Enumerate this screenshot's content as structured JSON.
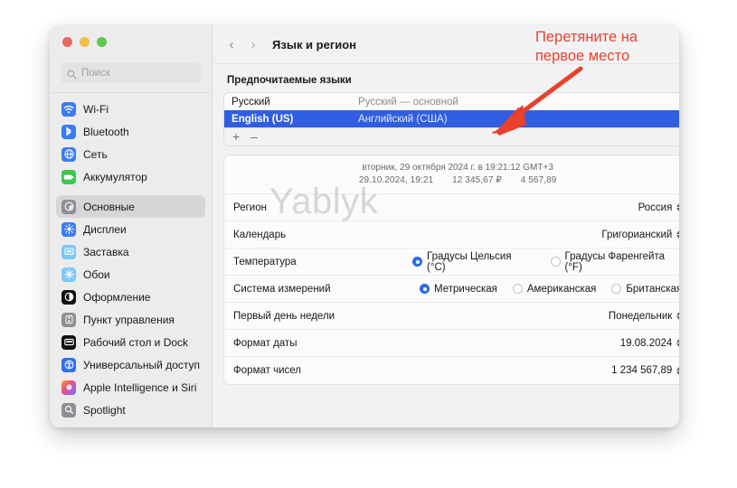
{
  "window": {
    "traffic_lights": [
      "close",
      "minimize",
      "zoom"
    ],
    "search": {
      "placeholder": "Поиск",
      "value": ""
    }
  },
  "sidebar": {
    "groups": [
      {
        "items": [
          {
            "label": "Wi-Fi",
            "icon": "wifi-icon",
            "color": "#3b7bf5",
            "selected": false
          },
          {
            "label": "Bluetooth",
            "icon": "bluetooth-icon",
            "color": "#3b7bf5",
            "selected": false
          },
          {
            "label": "Сеть",
            "icon": "network-globe-icon",
            "color": "#3b7bf5",
            "selected": false
          },
          {
            "label": "Аккумулятор",
            "icon": "battery-icon",
            "color": "#3cc750",
            "selected": false
          }
        ]
      },
      {
        "items": [
          {
            "label": "Основные",
            "icon": "general-gear-icon",
            "color": "#8e8e93",
            "selected": true
          },
          {
            "label": "Дисплеи",
            "icon": "display-brightness-icon",
            "color": "#3b7bf5",
            "selected": false
          },
          {
            "label": "Заставка",
            "icon": "screensaver-icon",
            "color": "#7fc7f5",
            "selected": false
          },
          {
            "label": "Обои",
            "icon": "wallpaper-icon",
            "color": "#7fc7f5",
            "selected": false
          },
          {
            "label": "Оформление",
            "icon": "appearance-contrast-icon",
            "color": "#111113",
            "selected": false
          },
          {
            "label": "Пункт управления",
            "icon": "control-center-icon",
            "color": "#8e8e93",
            "selected": false
          },
          {
            "label": "Рабочий стол и Dock",
            "icon": "desktop-dock-icon",
            "color": "#111113",
            "selected": false
          },
          {
            "label": "Универсальный доступ",
            "icon": "accessibility-icon",
            "color": "#2f6fe8",
            "selected": false
          },
          {
            "label": "Apple Intelligence и Siri",
            "icon": "siri-icon",
            "color": "#d96ab0",
            "selected": false
          },
          {
            "label": "Spotlight",
            "icon": "spotlight-search-icon",
            "color": "#8e8e93",
            "selected": false
          }
        ]
      }
    ]
  },
  "toolbar": {
    "back_label": "‹",
    "forward_label": "›",
    "title": "Язык и регион"
  },
  "languages": {
    "section_title": "Предпочитаемые языки",
    "rows": [
      {
        "name": "Русский",
        "desc": "Русский — основной",
        "selected": false
      },
      {
        "name": "English (US)",
        "desc": "Английский (США)",
        "selected": true
      }
    ],
    "add_label": "+",
    "remove_label": "–"
  },
  "preview": {
    "line1": "вторник, 29 октября 2024 г. в 19:21:12 GMT+3",
    "line2_date": "29.10.2024, 19:21",
    "line2_currency": "12 345,67 ₽",
    "line2_number": "4 567,89"
  },
  "settings": {
    "rows": [
      {
        "type": "popup",
        "label": "Регион",
        "value": "Россия"
      },
      {
        "type": "popup",
        "label": "Календарь",
        "value": "Григорианский"
      },
      {
        "type": "radio",
        "label": "Температура",
        "options": [
          {
            "label": "Градусы Цельсия (°C)",
            "selected": true
          },
          {
            "label": "Градусы Фаренгейта (°F)",
            "selected": false
          }
        ]
      },
      {
        "type": "radio",
        "label": "Система измерений",
        "options": [
          {
            "label": "Метрическая",
            "selected": true
          },
          {
            "label": "Американская",
            "selected": false
          },
          {
            "label": "Британская",
            "selected": false
          }
        ]
      },
      {
        "type": "popup",
        "label": "Первый день недели",
        "value": "Понедельник"
      },
      {
        "type": "popup",
        "label": "Формат даты",
        "value": "19.08.2024"
      },
      {
        "type": "popup",
        "label": "Формат чисел",
        "value": "1 234 567,89"
      }
    ]
  },
  "watermark": {
    "text": "Yablyk"
  },
  "annotation": {
    "line1": "Перетяните на",
    "line2": "первое место",
    "color": "#e8412c"
  },
  "colors": {
    "selection_blue": "#2f5fe0",
    "radio_blue": "#2f6fe8",
    "annotation_red": "#e8412c",
    "window_bg": "#f2f2f4",
    "sidebar_bg": "#ececed"
  }
}
